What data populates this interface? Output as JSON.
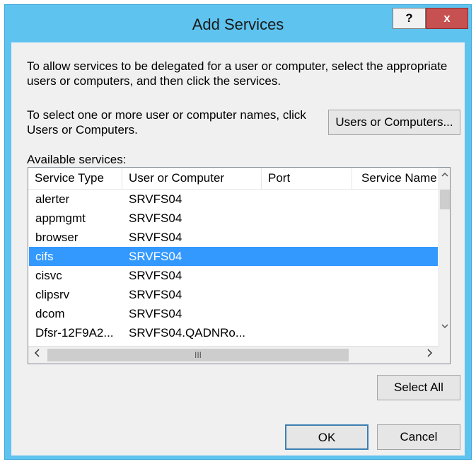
{
  "window": {
    "title": "Add Services",
    "help_label": "?",
    "close_label": "x"
  },
  "instructions": {
    "intro": "To allow services to be delegated for a user or computer, select the appropriate users or computers, and then click the services.",
    "select_text": "To select one or more user or computer names, click Users or Computers."
  },
  "buttons": {
    "users_or_computers": "Users or Computers...",
    "select_all": "Select All",
    "ok": "OK",
    "cancel": "Cancel"
  },
  "services": {
    "label": "Available services:",
    "columns": [
      "Service Type",
      "User or Computer",
      "Port",
      "Service Name"
    ],
    "rows": [
      {
        "service_type": "alerter",
        "user_or_computer": "SRVFS04",
        "port": "",
        "service_name": ""
      },
      {
        "service_type": "appmgmt",
        "user_or_computer": "SRVFS04",
        "port": "",
        "service_name": ""
      },
      {
        "service_type": "browser",
        "user_or_computer": "SRVFS04",
        "port": "",
        "service_name": ""
      },
      {
        "service_type": "cifs",
        "user_or_computer": "SRVFS04",
        "port": "",
        "service_name": "",
        "selected": true
      },
      {
        "service_type": "cisvc",
        "user_or_computer": "SRVFS04",
        "port": "",
        "service_name": ""
      },
      {
        "service_type": "clipsrv",
        "user_or_computer": "SRVFS04",
        "port": "",
        "service_name": ""
      },
      {
        "service_type": "dcom",
        "user_or_computer": "SRVFS04",
        "port": "",
        "service_name": ""
      },
      {
        "service_type": "Dfsr-12F9A2...",
        "user_or_computer": "SRVFS04.QADNRo...",
        "port": "",
        "service_name": ""
      }
    ]
  },
  "scrollbar": {
    "up_icon": "chevron-up-icon",
    "down_icon": "chevron-down-icon",
    "left_icon": "chevron-left-icon",
    "right_icon": "chevron-right-icon",
    "grip": "III"
  },
  "colors": {
    "frame": "#5fc3ef",
    "close": "#c75050",
    "selection": "#3399ff"
  }
}
